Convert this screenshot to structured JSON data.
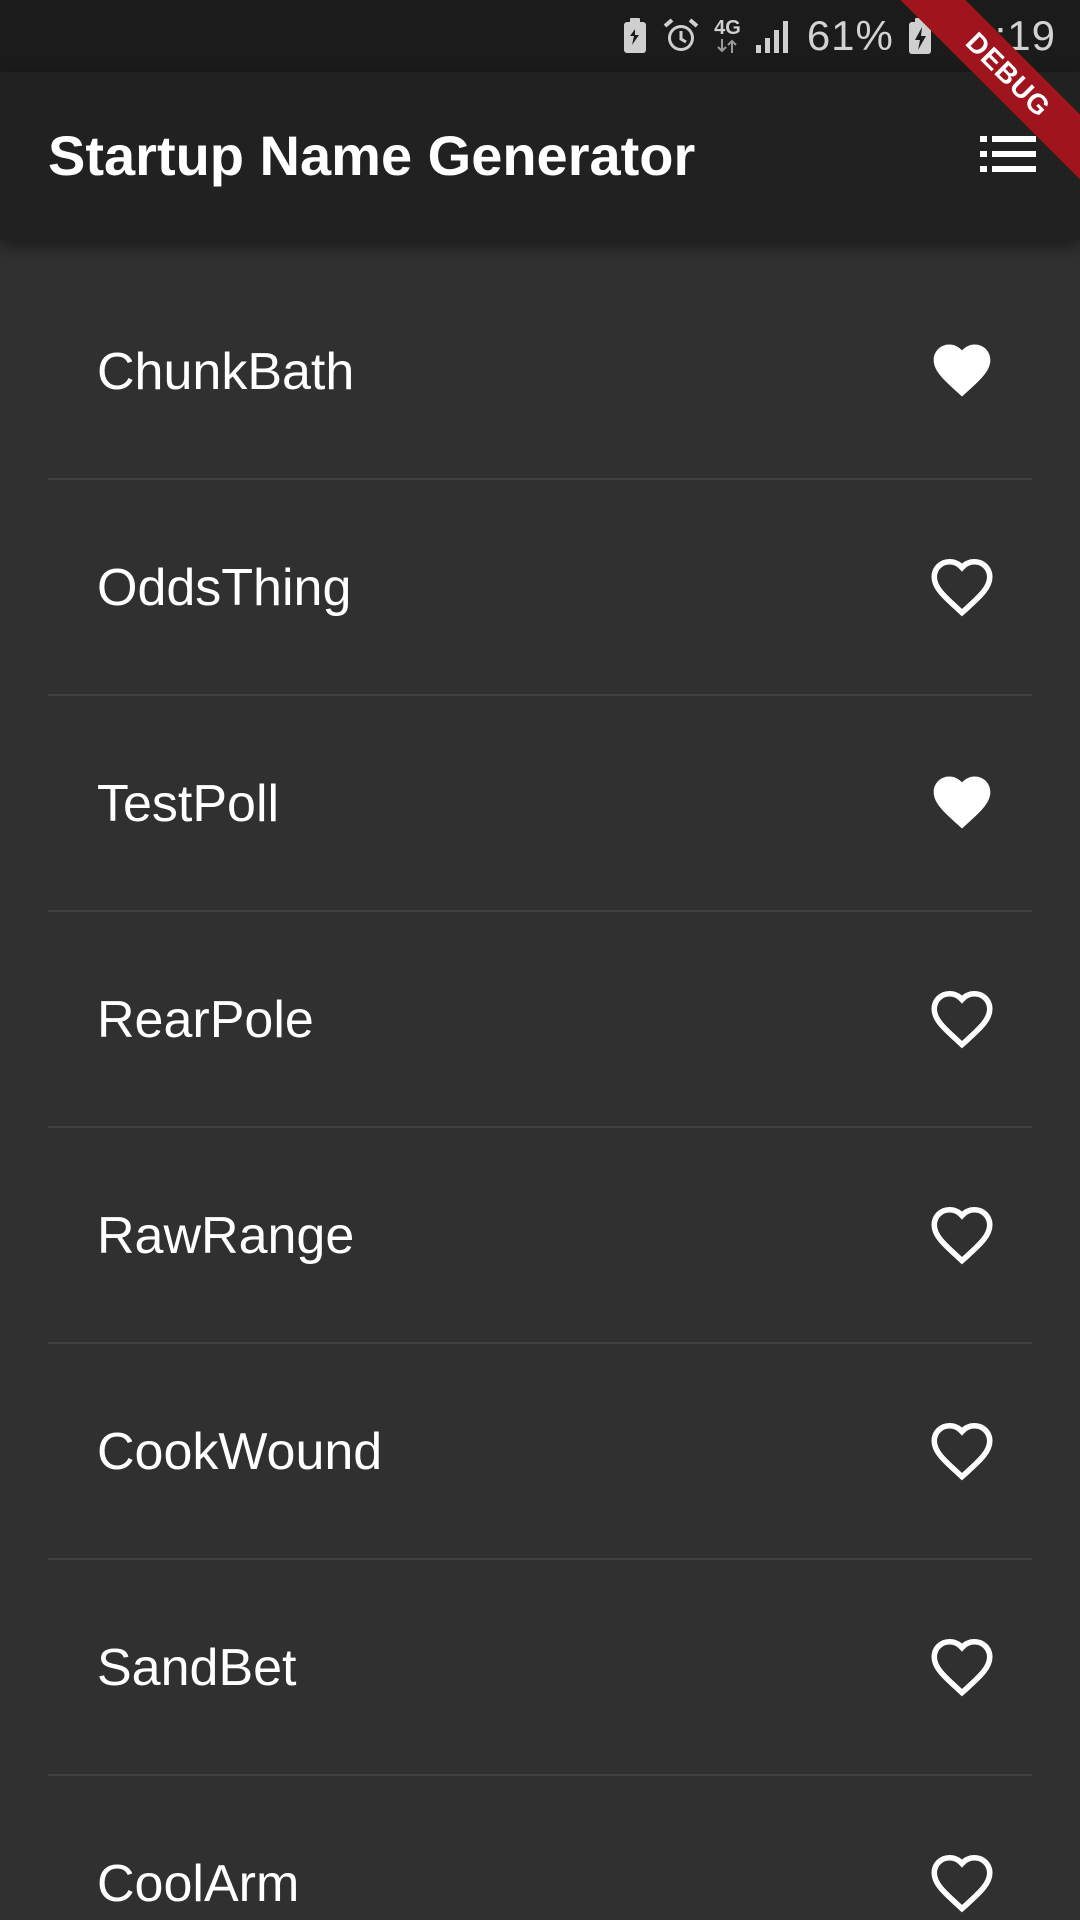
{
  "status_bar": {
    "network": "4G",
    "battery_percent": "61%",
    "time": "09:19",
    "icons": [
      "battery-saver-icon",
      "alarm-icon",
      "network-4g-icon",
      "signal-icon",
      "battery-charging-icon"
    ]
  },
  "app_bar": {
    "title": "Startup Name Generator",
    "action_icon": "list-icon"
  },
  "debug_banner": {
    "label": "DEBUG"
  },
  "colors": {
    "background": "#303030",
    "app_bar": "#212121",
    "status_bar": "#1b1b1b",
    "divider": "#414141",
    "debug_banner": "#a0141e",
    "text": "#ffffff"
  },
  "list": {
    "items": [
      {
        "name": "ChunkBath",
        "favorite": true
      },
      {
        "name": "OddsThing",
        "favorite": false
      },
      {
        "name": "TestPoll",
        "favorite": true
      },
      {
        "name": "RearPole",
        "favorite": false
      },
      {
        "name": "RawRange",
        "favorite": false
      },
      {
        "name": "CookWound",
        "favorite": false
      },
      {
        "name": "SandBet",
        "favorite": false
      },
      {
        "name": "CoolArm",
        "favorite": false
      }
    ]
  }
}
